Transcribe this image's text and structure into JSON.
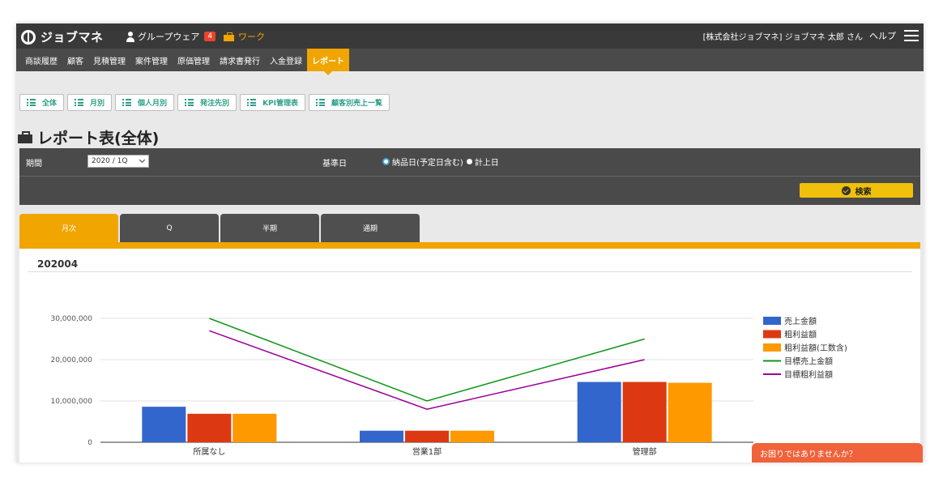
{
  "header": {
    "logo_text": "ジョブマネ",
    "groupware_label": "グループウェア",
    "groupware_badge": "4",
    "work_label": "ワーク",
    "user_label": "[株式会社ジョブマネ] ジョブマネ 太郎 さん",
    "help_label": "ヘルプ",
    "icons": [
      "logo-icon",
      "person-icon",
      "briefcase-icon",
      "hamburger-icon"
    ]
  },
  "menu": {
    "items": [
      "商談履歴",
      "顧客",
      "見積管理",
      "案件管理",
      "原価管理",
      "請求書発行",
      "入金登録",
      "レポート"
    ],
    "active": "レポート"
  },
  "report_buttons": [
    "全体",
    "月別",
    "個人月別",
    "発注先別",
    "KPI管理表",
    "顧客別売上一覧"
  ],
  "page_title": "レポート表(全体)",
  "filter": {
    "period_label": "期間",
    "period_value": "2020 / 1Q",
    "base_date_label": "基準日",
    "radio_options": [
      "納品日(予定日含む)",
      "計上日"
    ],
    "radio_selected": "納品日(予定日含む)",
    "search_label": "検索"
  },
  "tabs": {
    "items": [
      "月次",
      "Q",
      "半期",
      "通期"
    ],
    "active": "月次"
  },
  "period_heading": "202004",
  "help_tab_label": "お困りではありませんか？",
  "colors": {
    "accent": "#f0a500",
    "sales": "#3366cc",
    "gross_profit": "#dc3912",
    "gross_profit_incl": "#ff9900",
    "target_sales": "#109618",
    "target_profit": "#990099"
  },
  "chart_data": {
    "type": "bar",
    "categories": [
      "所属なし",
      "営業1部",
      "管理部"
    ],
    "series": [
      {
        "name": "売上金額",
        "type": "bar",
        "color": "#3366cc",
        "values": [
          8600000,
          2800000,
          14600000
        ]
      },
      {
        "name": "粗利益額",
        "type": "bar",
        "color": "#dc3912",
        "values": [
          6900000,
          2800000,
          14600000
        ]
      },
      {
        "name": "粗利益額(工数含)",
        "type": "bar",
        "color": "#ff9900",
        "values": [
          6900000,
          2800000,
          14400000
        ]
      },
      {
        "name": "目標売上金額",
        "type": "line",
        "color": "#109618",
        "values": [
          30000000,
          10000000,
          25000000
        ]
      },
      {
        "name": "目標粗利益額",
        "type": "line",
        "color": "#990099",
        "values": [
          27000000,
          8000000,
          20000000
        ]
      }
    ],
    "y_ticks": [
      "0",
      "10,000,000",
      "20,000,000",
      "30,000,000"
    ],
    "ylim": [
      0,
      30000000
    ],
    "grid": true,
    "legend_position": "right"
  }
}
